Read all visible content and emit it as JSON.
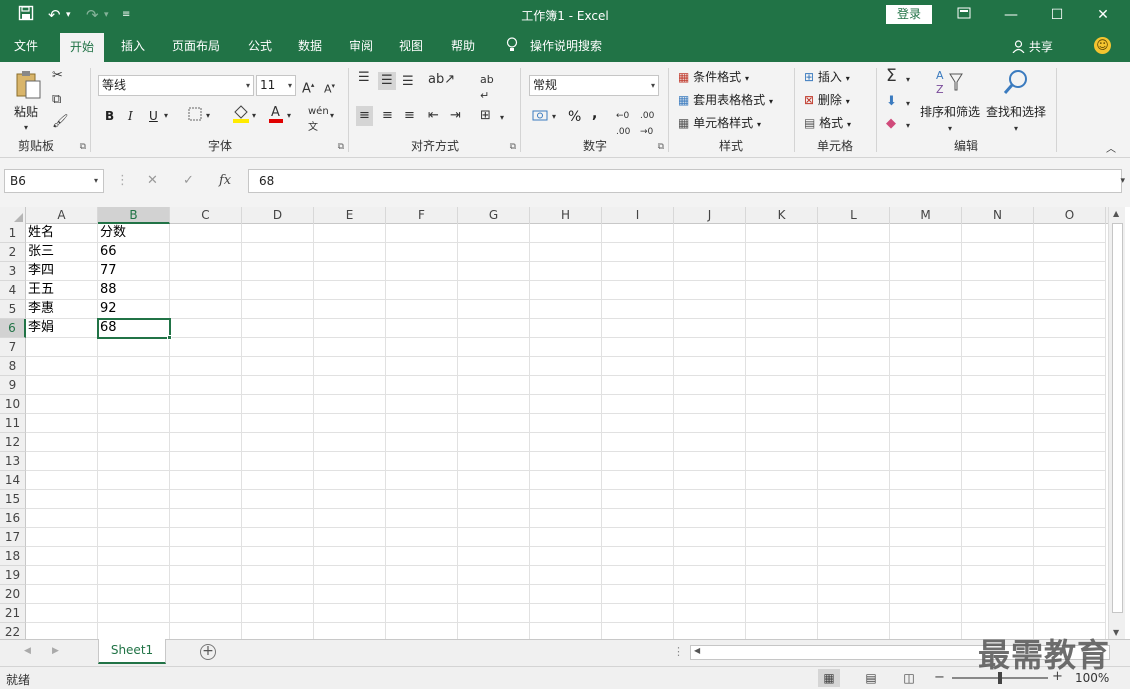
{
  "title_bar": {
    "title": "工作簿1  -  Excel",
    "login_label": "登录",
    "save_icon": "save-icon",
    "undo_icon": "undo-icon",
    "redo_icon": "redo-icon"
  },
  "menu": {
    "tabs": [
      "文件",
      "开始",
      "插入",
      "页面布局",
      "公式",
      "数据",
      "审阅",
      "视图",
      "帮助",
      "操作说明搜索"
    ],
    "active_tab": "开始",
    "share_label": "共享"
  },
  "ribbon": {
    "clipboard": {
      "paste_label": "粘贴",
      "group_label": "剪贴板"
    },
    "font": {
      "font_name": "等线",
      "font_size": "11",
      "bold": "B",
      "italic": "I",
      "underline": "U",
      "group_label": "字体"
    },
    "alignment": {
      "group_label": "对齐方式"
    },
    "number": {
      "format": "常规",
      "percent": "%",
      "comma": ",",
      "group_label": "数字"
    },
    "styles": {
      "conditional_format": "条件格式",
      "table_format": "套用表格格式",
      "cell_styles": "单元格样式",
      "group_label": "样式"
    },
    "cells": {
      "insert": "插入",
      "delete": "删除",
      "format": "格式",
      "group_label": "单元格"
    },
    "editing": {
      "sort_filter": "排序和筛选",
      "find_select": "查找和选择",
      "group_label": "编辑"
    }
  },
  "formula_bar": {
    "name_box": "B6",
    "formula": "68",
    "fx_label": "fx"
  },
  "grid": {
    "columns": [
      "A",
      "B",
      "C",
      "D",
      "E",
      "F",
      "G",
      "H",
      "I",
      "J",
      "K",
      "L",
      "M",
      "N",
      "O"
    ],
    "row_numbers": [
      "1",
      "2",
      "3",
      "4",
      "5",
      "6",
      "7",
      "8",
      "9",
      "10",
      "11",
      "12",
      "13",
      "14",
      "15",
      "16",
      "17",
      "18",
      "19",
      "20",
      "21",
      "22"
    ],
    "cells": [
      [
        "姓名",
        "分数"
      ],
      [
        "张三",
        "66"
      ],
      [
        "李四",
        "77"
      ],
      [
        "王五",
        "88"
      ],
      [
        "李惠",
        "92"
      ],
      [
        "李娟",
        "68"
      ]
    ],
    "active_cell": {
      "col": "B",
      "row": "6"
    }
  },
  "sheet_tabs": {
    "tabs": [
      "Sheet1"
    ],
    "add_label": "+"
  },
  "status_bar": {
    "status": "就绪",
    "zoom": "100%"
  },
  "watermark": "最需教育"
}
